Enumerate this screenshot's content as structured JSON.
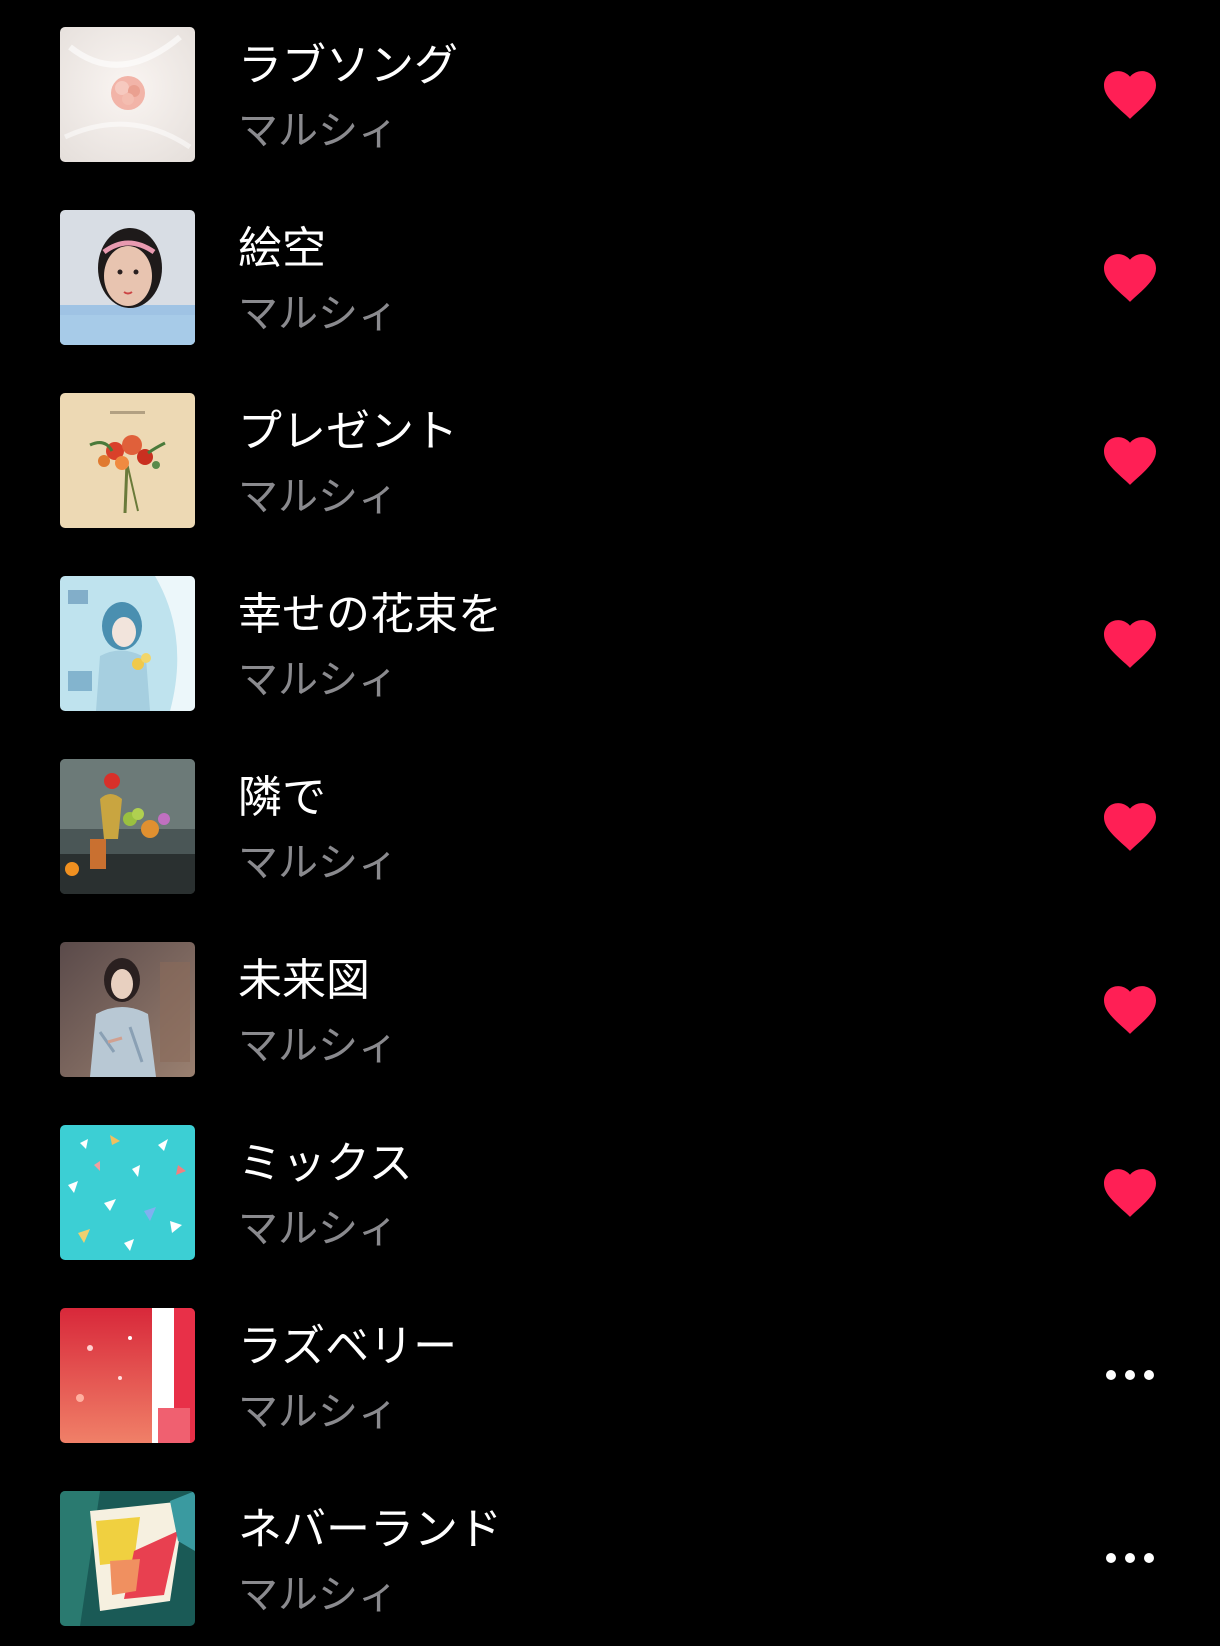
{
  "colors": {
    "background": "#000000",
    "title": "#ffffff",
    "artist": "#8a8a8e",
    "heart": "#ff1f55"
  },
  "songs": [
    {
      "title": "ラブソング",
      "artist": "マルシィ",
      "action": "heart-icon"
    },
    {
      "title": "絵空",
      "artist": "マルシィ",
      "action": "heart-icon"
    },
    {
      "title": "プレゼント",
      "artist": "マルシィ",
      "action": "heart-icon"
    },
    {
      "title": "幸せの花束を",
      "artist": "マルシィ",
      "action": "heart-icon"
    },
    {
      "title": "隣で",
      "artist": "マルシィ",
      "action": "heart-icon"
    },
    {
      "title": "未来図",
      "artist": "マルシィ",
      "action": "heart-icon"
    },
    {
      "title": "ミックス",
      "artist": "マルシィ",
      "action": "heart-icon"
    },
    {
      "title": "ラズベリー",
      "artist": "マルシィ",
      "action": "more-icon"
    },
    {
      "title": "ネバーランド",
      "artist": "マルシィ",
      "action": "more-icon"
    }
  ]
}
